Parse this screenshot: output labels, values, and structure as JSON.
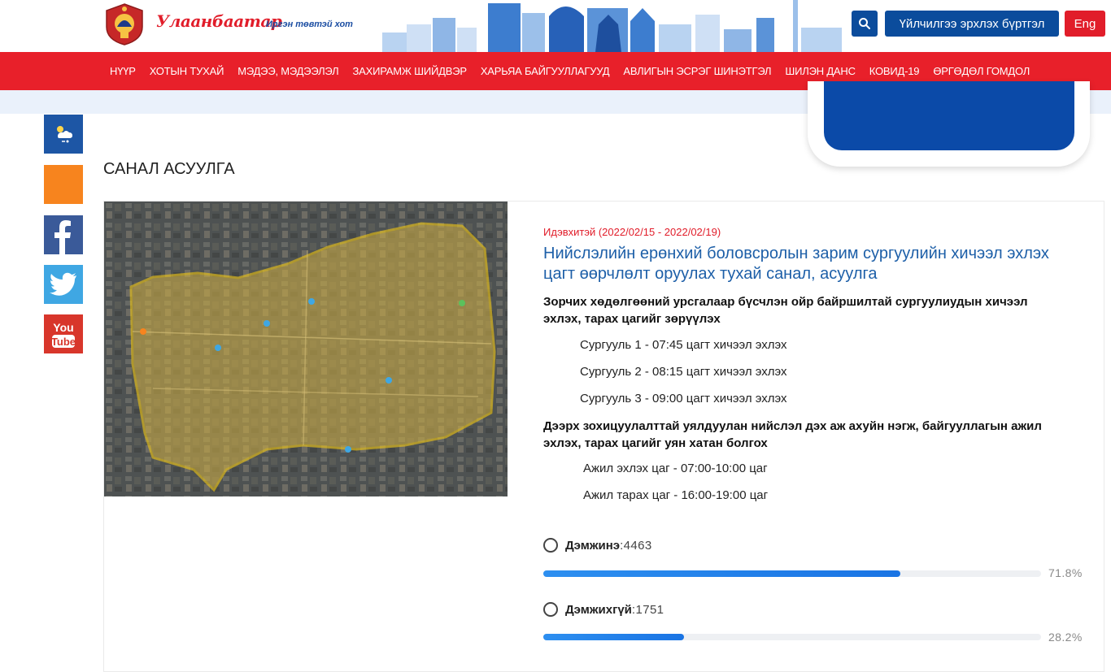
{
  "header": {
    "brand": "Улаанбаатар",
    "slogan": "Иргэн төвтэй хот",
    "register_label": "Үйлчилгээ эрхлэх бүртгэл",
    "lang_label": "Eng"
  },
  "nav": {
    "items": [
      "НҮҮР",
      "ХОТЫН ТУХАЙ",
      "МЭДЭЭ, МЭДЭЭЛЭЛ",
      "ЗАХИРАМЖ ШИЙДВЭР",
      "ХАРЬЯА БАЙГУУЛЛАГУУД",
      "АВЛИГЫН ЭСРЭГ ШИНЭТГЭЛ",
      "ШИЛЭН ДАНС",
      "КОВИД-19",
      "ӨРГӨДӨЛ ГОМДОЛ"
    ]
  },
  "page": {
    "title": "САНАЛ АСУУЛГА"
  },
  "poll": {
    "period": "Идэвхитэй (2022/02/15 - 2022/02/19)",
    "title": "Нийслэлийн ерөнхий боловсролын зарим сургуулийн хичээл эхлэх цагт өөрчлөлт оруулах тухай санал, асуулга",
    "heading1": "Зорчих хөдөлгөөний урсгалаар бүсчлэн ойр байршилтай сургуулиудын хичээл эхлэх, тарах цагийг зөрүүлэх",
    "lines1": [
      "Сургууль 1 - 07:45 цагт хичээл эхлэх",
      "Сургууль 2 - 08:15 цагт хичээл эхлэх",
      "Сургууль 3 - 09:00 цагт хичээл эхлэх"
    ],
    "heading2": "Дээрх зохицуулалттай уялдуулан нийслэл дэх аж ахуйн нэгж, байгууллагын ажил эхлэх, тарах цагийг уян хатан болгох",
    "lines2": [
      "Ажил эхлэх цаг - 07:00-10:00 цаг",
      "Ажил тарах цаг - 16:00-19:00 цаг"
    ],
    "options": [
      {
        "label": "Дэмжинэ",
        "count": ":4463",
        "percent_text": "71.8%",
        "percent": 71.8
      },
      {
        "label": "Дэмжихгүй",
        "count": ":1751",
        "percent_text": "28.2%",
        "percent": 28.2
      }
    ]
  },
  "colors": {
    "brand_red": "#e8202a",
    "brand_blue": "#0b4c9c",
    "bar_blue": "#1a74e4"
  }
}
